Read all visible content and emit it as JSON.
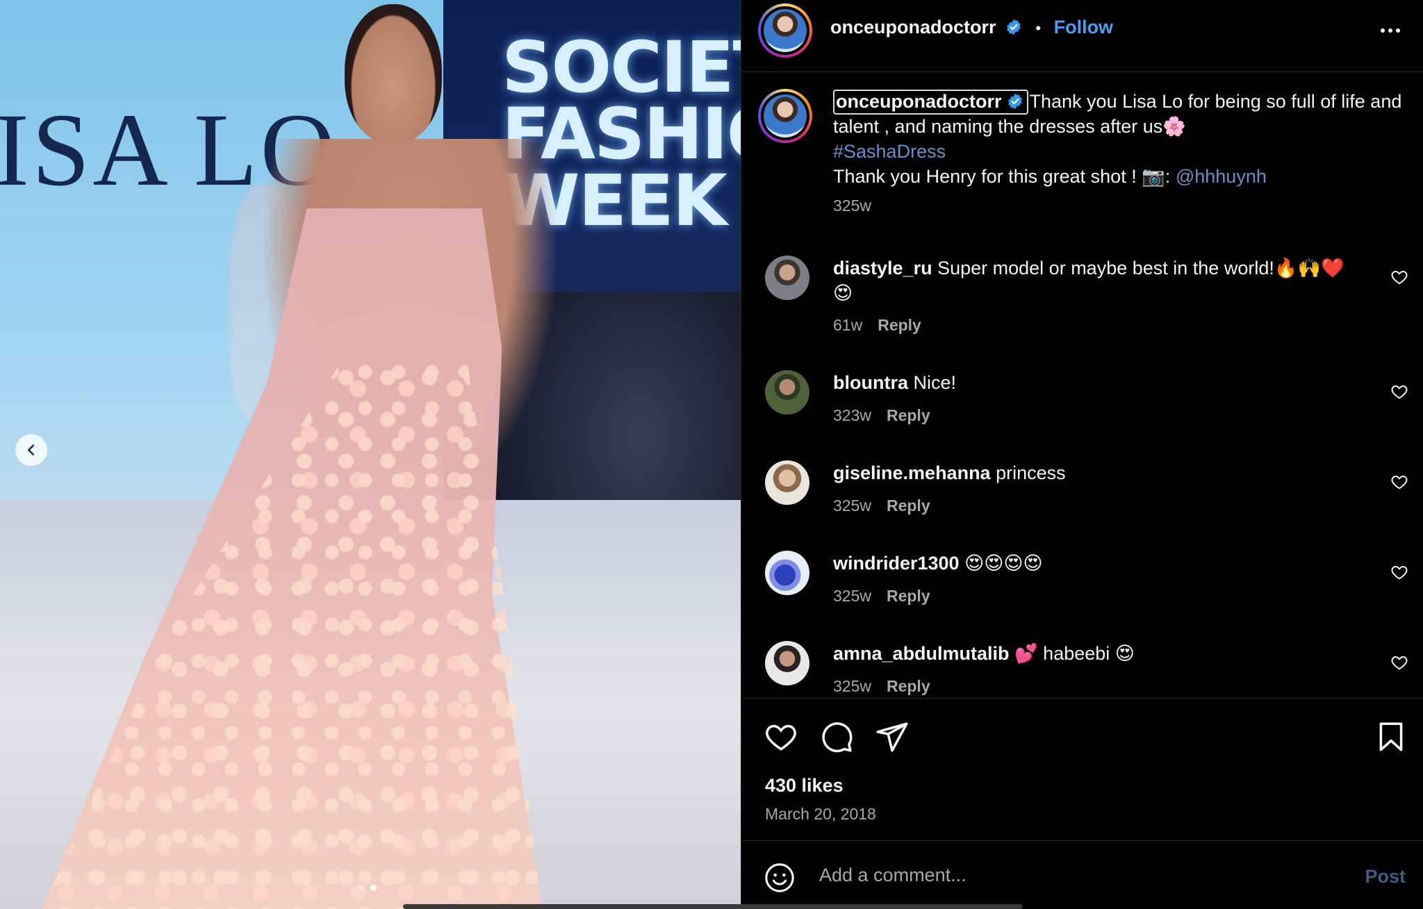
{
  "photo": {
    "stage_text_left": "ISA LO",
    "stage_text_right": "SOCIETY\nFASHION\nWEEK",
    "carousel_dots": 2,
    "active_dot": 1
  },
  "header": {
    "username": "onceuponadoctorr",
    "follow_label": "Follow",
    "separator": "•"
  },
  "caption": {
    "username": "onceuponadoctorr",
    "text_1": "Thank you Lisa Lo for being so full of life and talent , and naming the dresses after us🌸",
    "hashtag": "#SashaDress",
    "text_2": "Thank you Henry for this great shot ! 📷: ",
    "mention": "@hhhuynh",
    "time": "325w"
  },
  "comments": [
    {
      "username": "diastyle_ru",
      "text": "Super model or maybe best in the world!🔥🙌❤️😍",
      "time": "61w",
      "reply_label": "Reply"
    },
    {
      "username": "blountra",
      "text": "Nice!",
      "time": "323w",
      "reply_label": "Reply"
    },
    {
      "username": "giseline.mehanna",
      "text": "princess",
      "time": "325w",
      "reply_label": "Reply"
    },
    {
      "username": "windrider1300",
      "text": "😍😍😍😍",
      "time": "325w",
      "reply_label": "Reply"
    },
    {
      "username": "amna_abdulmutalib",
      "text": "💕 habeebi 😍",
      "time": "325w",
      "reply_label": "Reply"
    }
  ],
  "post_footer": {
    "likes": "430 likes",
    "date": "March 20, 2018"
  },
  "comment_bar": {
    "placeholder": "Add a comment...",
    "post_label": "Post"
  },
  "colors": {
    "accent": "#4a9df0",
    "link": "#6b8ec9",
    "secondary_text": "#a8a8a8",
    "border": "#262626"
  }
}
